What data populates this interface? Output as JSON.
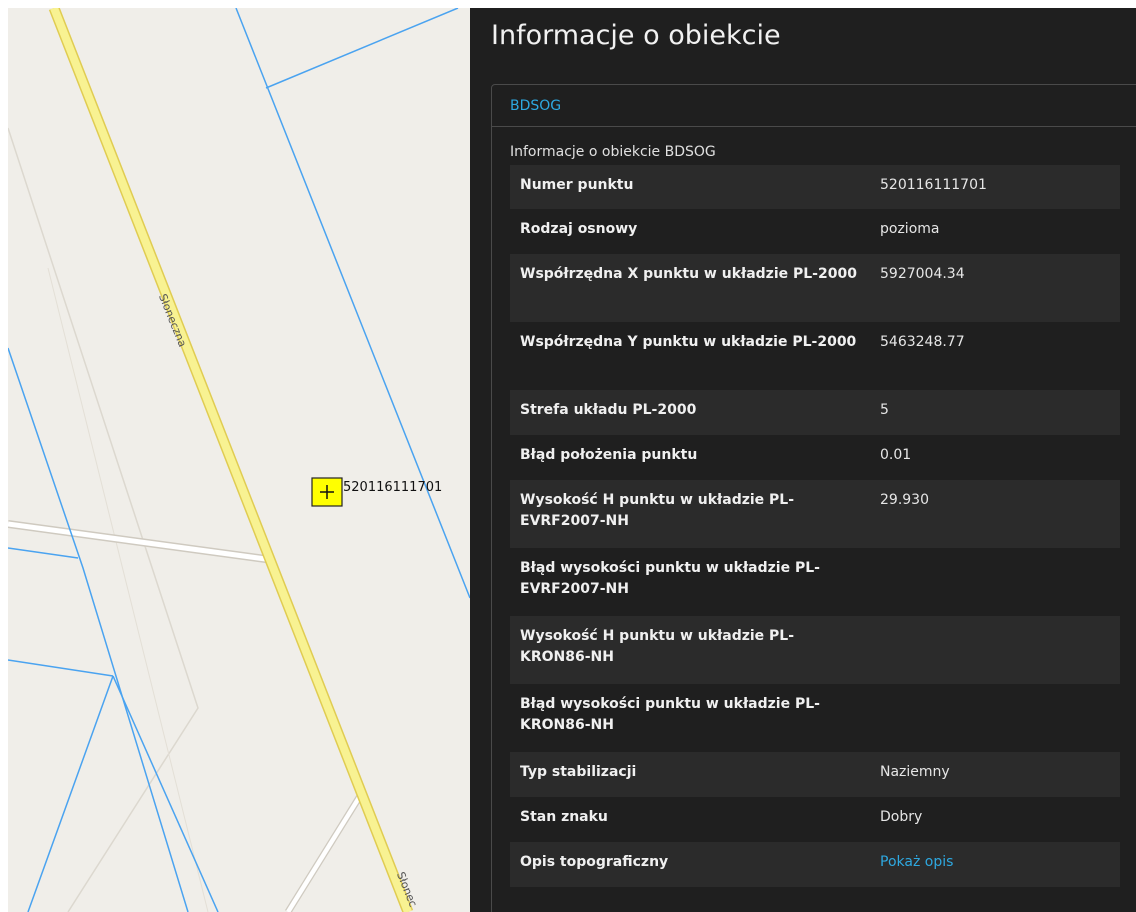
{
  "map": {
    "point_label": "520116111701",
    "street_name": "Słoneczna",
    "street_name_bottom": "Słonec",
    "colors": {
      "background": "#f0eee9",
      "main_road": "#f8f292",
      "main_road_edge": "#e8d55a",
      "parcel_line": "#4aa3f0",
      "minor_road": "#ffffff",
      "point_fill": "#ffff00"
    }
  },
  "panel": {
    "title": "Informacje o obiekcie",
    "card": {
      "header_link": "BDSOG",
      "subtitle": "Informacje o obiekcie BDSOG",
      "rows": [
        {
          "key": "Numer punktu",
          "value": "520116111701"
        },
        {
          "key": "Rodzaj osnowy",
          "value": "pozioma"
        },
        {
          "key": "Współrzędna X punktu w układzie PL-2000",
          "value": "5927004.34"
        },
        {
          "key": "Współrzędna Y punktu w układzie PL-2000",
          "value": "5463248.77"
        },
        {
          "key": "Strefa układu PL-2000",
          "value": "5"
        },
        {
          "key": "Błąd położenia punktu",
          "value": "0.01"
        },
        {
          "key": "Wysokość H punktu w układzie PL-EVRF2007-NH",
          "value": "29.930"
        },
        {
          "key": "Błąd wysokości punktu w układzie PL-EVRF2007-NH",
          "value": ""
        },
        {
          "key": "Wysokość H punktu w układzie PL-KRON86-NH",
          "value": ""
        },
        {
          "key": "Błąd wysokości punktu w układzie PL-KRON86-NH",
          "value": ""
        },
        {
          "key": "Typ stabilizacji",
          "value": "Naziemny"
        },
        {
          "key": "Stan znaku",
          "value": "Dobry"
        },
        {
          "key": "Opis topograficzny",
          "value": "Pokaż opis",
          "is_link": true
        }
      ]
    },
    "colors": {
      "background": "#1f1f1f",
      "row_alt": "#2b2b2b",
      "link": "#2ea8e0"
    }
  }
}
